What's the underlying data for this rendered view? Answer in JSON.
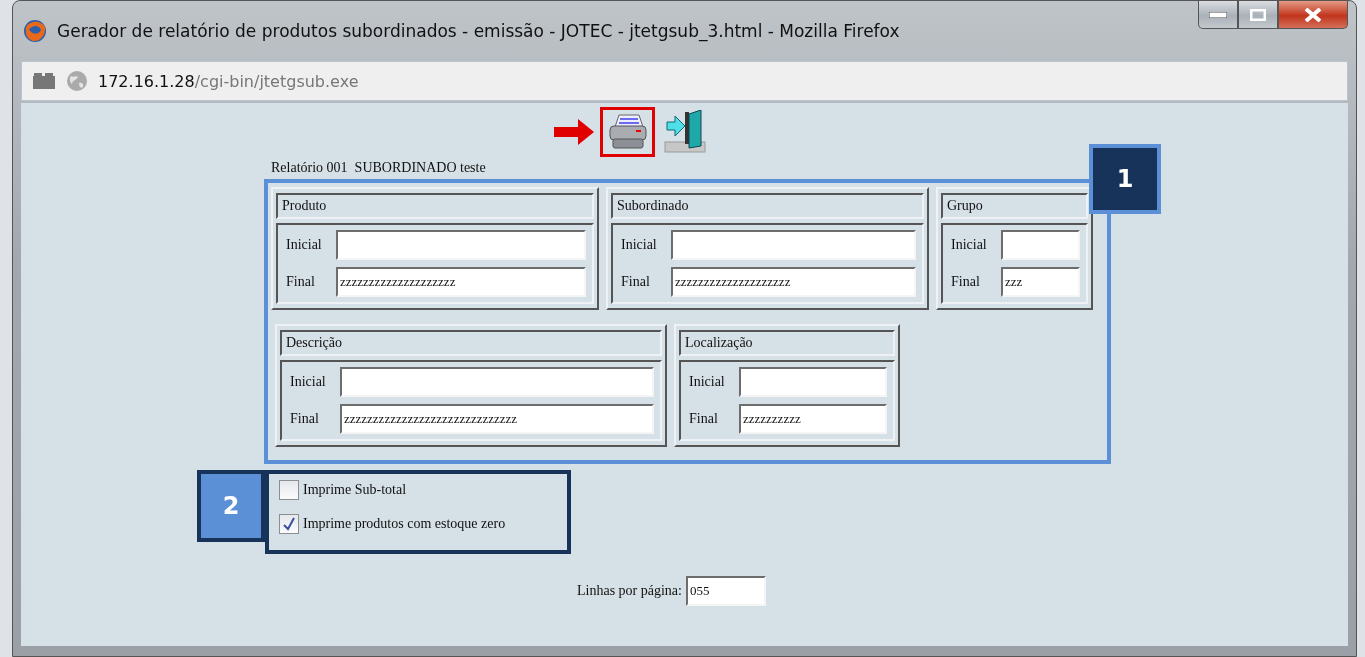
{
  "window": {
    "title": "Gerador de relatório de produtos subordinados - emissão - JOTEC - jtetgsub_3.html - Mozilla Firefox"
  },
  "address": {
    "host": "172.16.1.28",
    "path": "/cgi-bin/jtetgsub.exe"
  },
  "toolbar": {
    "print_highlighted": true
  },
  "report_title": "Relatório 001  SUBORDINADO teste",
  "callouts": [
    {
      "label": "1"
    },
    {
      "label": "2"
    }
  ],
  "filter_rows": [
    [
      {
        "title": "Produto",
        "fields": [
          {
            "label": "Inicial"
          },
          {
            "label": "Final",
            "value": "zzzzzzzzzzzzzzzzzzzz"
          }
        ]
      },
      {
        "title": "Subordinado",
        "fields": [
          {
            "label": "Inicial"
          },
          {
            "label": "Final",
            "value": "zzzzzzzzzzzzzzzzzzzz"
          }
        ]
      },
      {
        "title": "Grupo",
        "fields": [
          {
            "label": "Inicial"
          },
          {
            "label": "Final",
            "value": "zzz"
          }
        ]
      }
    ],
    [
      {
        "title": "Descrição",
        "fields": [
          {
            "label": "Inicial"
          },
          {
            "label": "Final",
            "value": "zzzzzzzzzzzzzzzzzzzzzzzzzzzzzz"
          }
        ]
      },
      {
        "title": "Localização",
        "fields": [
          {
            "label": "Inicial"
          },
          {
            "label": "Final",
            "value": "zzzzzzzzzz"
          }
        ]
      }
    ]
  ],
  "options": [
    {
      "label": "Imprime Sub-total",
      "checked": false
    },
    {
      "label": "Imprime produtos com estoque zero",
      "checked": true
    }
  ],
  "lines_per_page": {
    "label": "Linhas por página:",
    "value": "055"
  }
}
